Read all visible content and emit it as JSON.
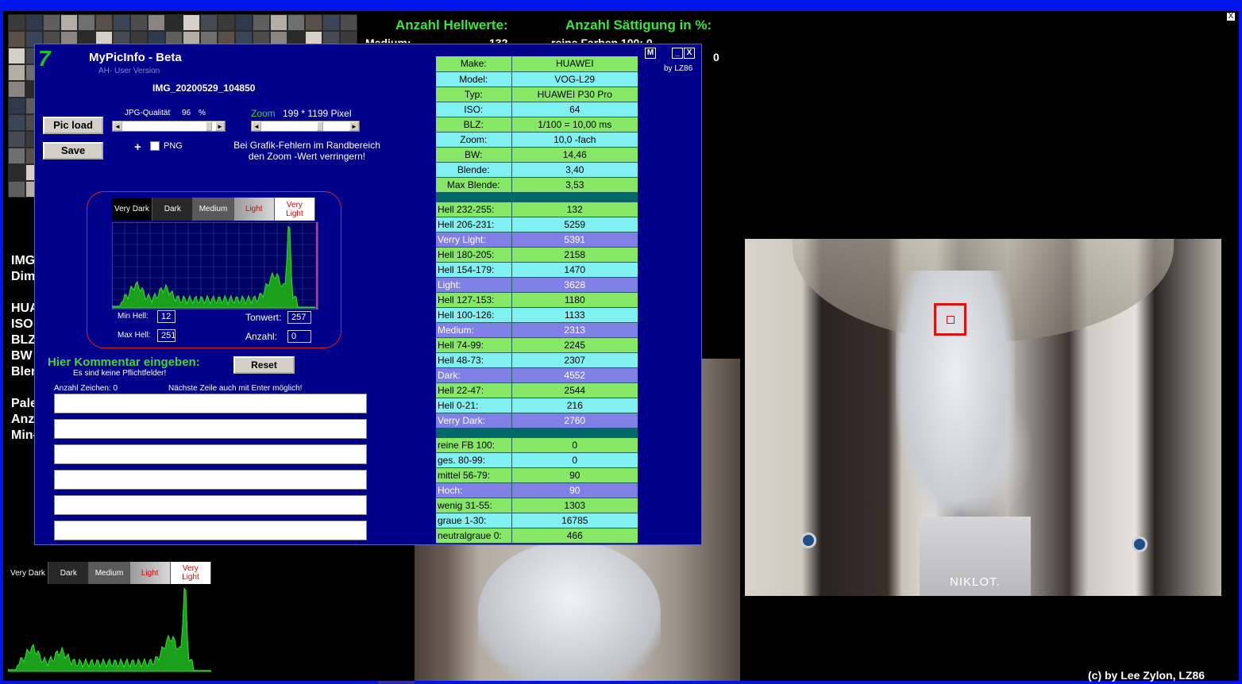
{
  "window": {
    "close_glyph": "X"
  },
  "background": {
    "hellwerte_title": "Anzahl Hellwerte:",
    "saettigung_title": "Anzahl Sättigung in %:",
    "partial_row": "Medium:",
    "partial_val": "132",
    "partial_sat": "reine Farben 100: 0",
    "count_zero": "0",
    "left_labels": [
      "IMG",
      "Dim",
      "HUA",
      "ISO",
      "BLZ",
      "BW",
      "Blen",
      "Pale",
      "Anz",
      "Min-"
    ],
    "plaque_text": "NIKLOT.",
    "copyright": "(c) by Lee Zylon, LZ86"
  },
  "zones": [
    "Very Dark",
    "Dark",
    "Medium",
    "Light",
    "Very Light"
  ],
  "dialog": {
    "logo": "7",
    "title": "MyPicInfo - Beta",
    "subtitle": "AH- User Version",
    "filename": "IMG_20200529_104850",
    "load_button": "Pic load",
    "save_button": "Save",
    "jpg_quality_label": "JPG-Qualität",
    "jpg_quality_value": "96",
    "jpg_quality_unit": "%",
    "jpg_quality_level": 0.96,
    "zoom_label": "Zoom",
    "zoom_value": "199 * 1199 Pixel",
    "zoom_level": 0.68,
    "plus": "+",
    "png_label": "PNG",
    "warning": "Bei Grafik-Fehlern im Randbereich den Zoom -Wert verringern!",
    "min_hell_label": "Min Hell:",
    "min_hell_value": "12",
    "max_hell_label": "Max Hell:",
    "max_hell_value": "251",
    "tonwert_label": "Tonwert:",
    "tonwert_value": "257",
    "anzahl_label": "Anzahl:",
    "anzahl_value": "0",
    "comment_title": "Hier Kommentar eingeben:",
    "comment_sub": "Es sind keine Pflichtfelder!",
    "reset_button": "Reset",
    "char_count": "Anzahl Zeichen: 0",
    "enter_hint": "Nächste Zeile auch mit Enter möglich!",
    "comment_lines": [
      "",
      "",
      "",
      "",
      "",
      ""
    ],
    "win_m": "M",
    "win_min": "_",
    "win_close": "X",
    "by": "by LZ86"
  },
  "table": {
    "exif": [
      {
        "label": "Make:",
        "value": "HUAWEI",
        "style": "g"
      },
      {
        "label": "Model:",
        "value": "VOG-L29",
        "style": "c"
      },
      {
        "label": "Typ:",
        "value": "HUAWEI P30 Pro",
        "style": "g"
      },
      {
        "label": "ISO:",
        "value": "64",
        "style": "c"
      },
      {
        "label": "BLZ:",
        "value": "1/100 = 10,00 ms",
        "style": "g"
      },
      {
        "label": "Zoom:",
        "value": "10,0 -fach",
        "style": "c"
      },
      {
        "label": "BW:",
        "value": "14,46",
        "style": "g"
      },
      {
        "label": "Blende:",
        "value": "3,40",
        "style": "c"
      },
      {
        "label": "Max Blende:",
        "value": "3,53",
        "style": "g"
      }
    ],
    "brightness": [
      {
        "label": "Hell 232-255:",
        "value": "132",
        "style": "g"
      },
      {
        "label": "Hell 206-231:",
        "value": "5259",
        "style": "c"
      },
      {
        "label": "Verry Light:",
        "value": "5391",
        "style": "b"
      },
      {
        "label": "Hell 180-205:",
        "value": "2158",
        "style": "g"
      },
      {
        "label": "Hell 154-179:",
        "value": "1470",
        "style": "c"
      },
      {
        "label": "Light:",
        "value": "3628",
        "style": "b"
      },
      {
        "label": "Hell 127-153:",
        "value": "1180",
        "style": "g"
      },
      {
        "label": "Hell 100-126:",
        "value": "1133",
        "style": "c"
      },
      {
        "label": "Medium:",
        "value": "2313",
        "style": "b"
      },
      {
        "label": "Hell 74-99:",
        "value": "2245",
        "style": "g"
      },
      {
        "label": "Hell 48-73:",
        "value": "2307",
        "style": "c"
      },
      {
        "label": "Dark:",
        "value": "4552",
        "style": "b"
      },
      {
        "label": "Hell 22-47:",
        "value": "2544",
        "style": "g"
      },
      {
        "label": "Hell 0-21:",
        "value": "216",
        "style": "c"
      },
      {
        "label": "Verry Dark:",
        "value": "2760",
        "style": "b"
      }
    ],
    "saturation": [
      {
        "label": "reine FB 100:",
        "value": "0",
        "style": "g"
      },
      {
        "label": "ges. 80-99:",
        "value": "0",
        "style": "c"
      },
      {
        "label": "mittel 56-79:",
        "value": "90",
        "style": "g"
      },
      {
        "label": "Hoch:",
        "value": "90",
        "style": "b"
      },
      {
        "label": "wenig 31-55:",
        "value": "1303",
        "style": "g"
      },
      {
        "label": "graue  1-30:",
        "value": "16785",
        "style": "c"
      },
      {
        "label": "neutralgraue 0:",
        "value": "466",
        "style": "g"
      }
    ]
  },
  "colors": {
    "dialog_bg": "#00008a",
    "accent_green": "#3cd63c",
    "frame_blue": "#0016e8"
  }
}
